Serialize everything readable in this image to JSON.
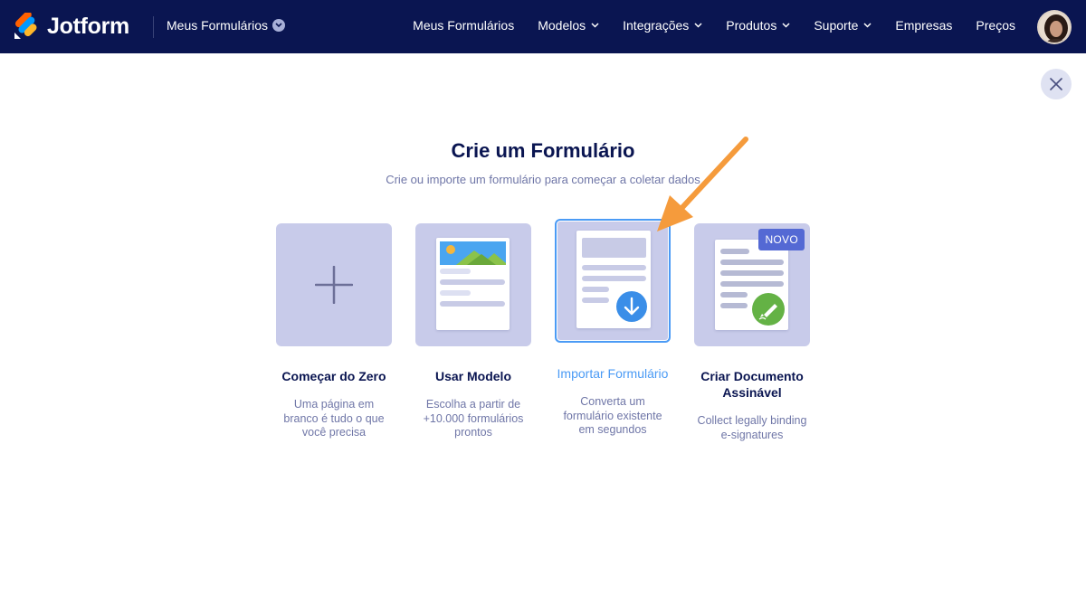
{
  "header": {
    "brand": "Jotform",
    "workspace_dropdown": "Meus Formulários",
    "nav": [
      {
        "label": "Meus Formulários",
        "has_chevron": false
      },
      {
        "label": "Modelos",
        "has_chevron": true
      },
      {
        "label": "Integrações",
        "has_chevron": true
      },
      {
        "label": "Produtos",
        "has_chevron": true
      },
      {
        "label": "Suporte",
        "has_chevron": true
      },
      {
        "label": "Empresas",
        "has_chevron": false
      },
      {
        "label": "Preços",
        "has_chevron": false
      }
    ]
  },
  "modal": {
    "title": "Crie um Formulário",
    "subtitle": "Crie ou importe um formulário para começar a coletar dados",
    "options": [
      {
        "label": "Começar do Zero",
        "description": "Uma página em branco é tudo o que você precisa",
        "icon": "plus-icon"
      },
      {
        "label": "Usar Modelo",
        "description": "Escolha a partir de +10.000 formulários prontos",
        "icon": "template-icon"
      },
      {
        "label": "Importar Formulário",
        "description": "Converta um formulário existente em segundos",
        "icon": "import-icon",
        "selected": true
      },
      {
        "label": "Criar Documento Assinável",
        "description": "Collect legally binding e-signatures",
        "icon": "sign-document-icon",
        "badge": "NOVO"
      }
    ]
  },
  "colors": {
    "header_bg": "#0a1551",
    "tile_bg": "#c8cbea",
    "accent_blue": "#4b9bf5",
    "arrow_orange": "#f59b3c",
    "badge_bg": "#5469d4",
    "sign_green": "#64b245"
  }
}
